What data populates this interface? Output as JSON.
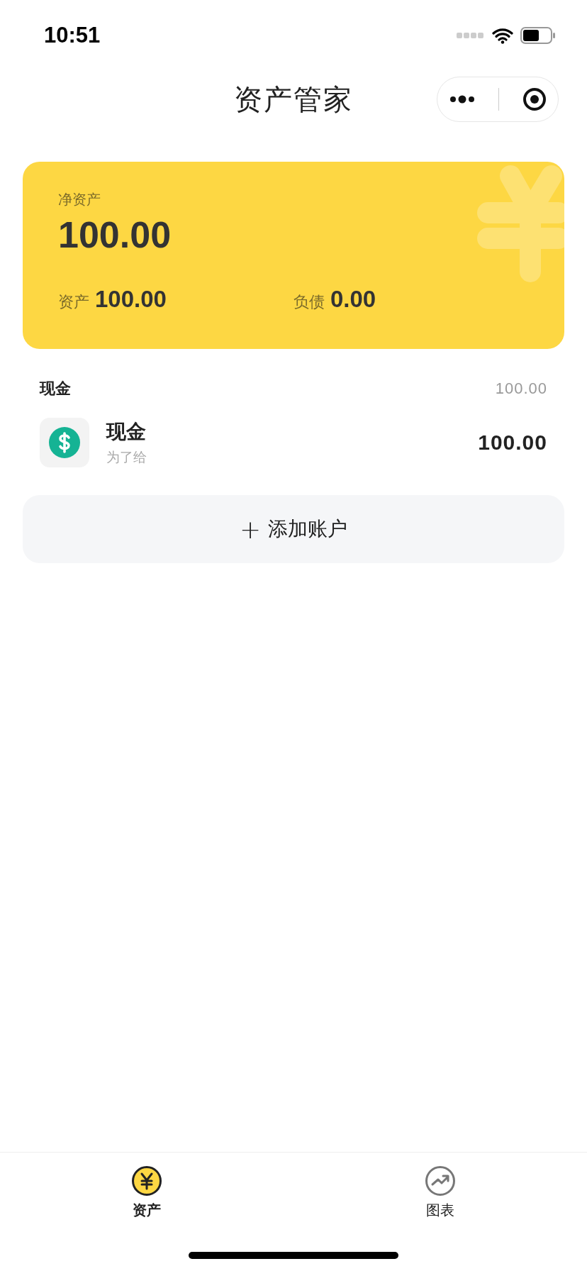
{
  "status_bar": {
    "time": "10:51"
  },
  "nav": {
    "title": "资产管家"
  },
  "summary": {
    "net_label": "净资产",
    "net_value": "100.00",
    "assets_label": "资产",
    "assets_value": "100.00",
    "liabilities_label": "负债",
    "liabilities_value": "0.00"
  },
  "groups": [
    {
      "name": "现金",
      "total": "100.00",
      "accounts": [
        {
          "name": "现金",
          "note": "为了给",
          "balance": "100.00",
          "kind": "cash"
        }
      ]
    }
  ],
  "add_button": {
    "icon": "+",
    "label": "添加账户"
  },
  "tabs": [
    {
      "label": "资产",
      "selected": true,
      "kind": "assets"
    },
    {
      "label": "图表",
      "selected": false,
      "kind": "chart"
    }
  ]
}
